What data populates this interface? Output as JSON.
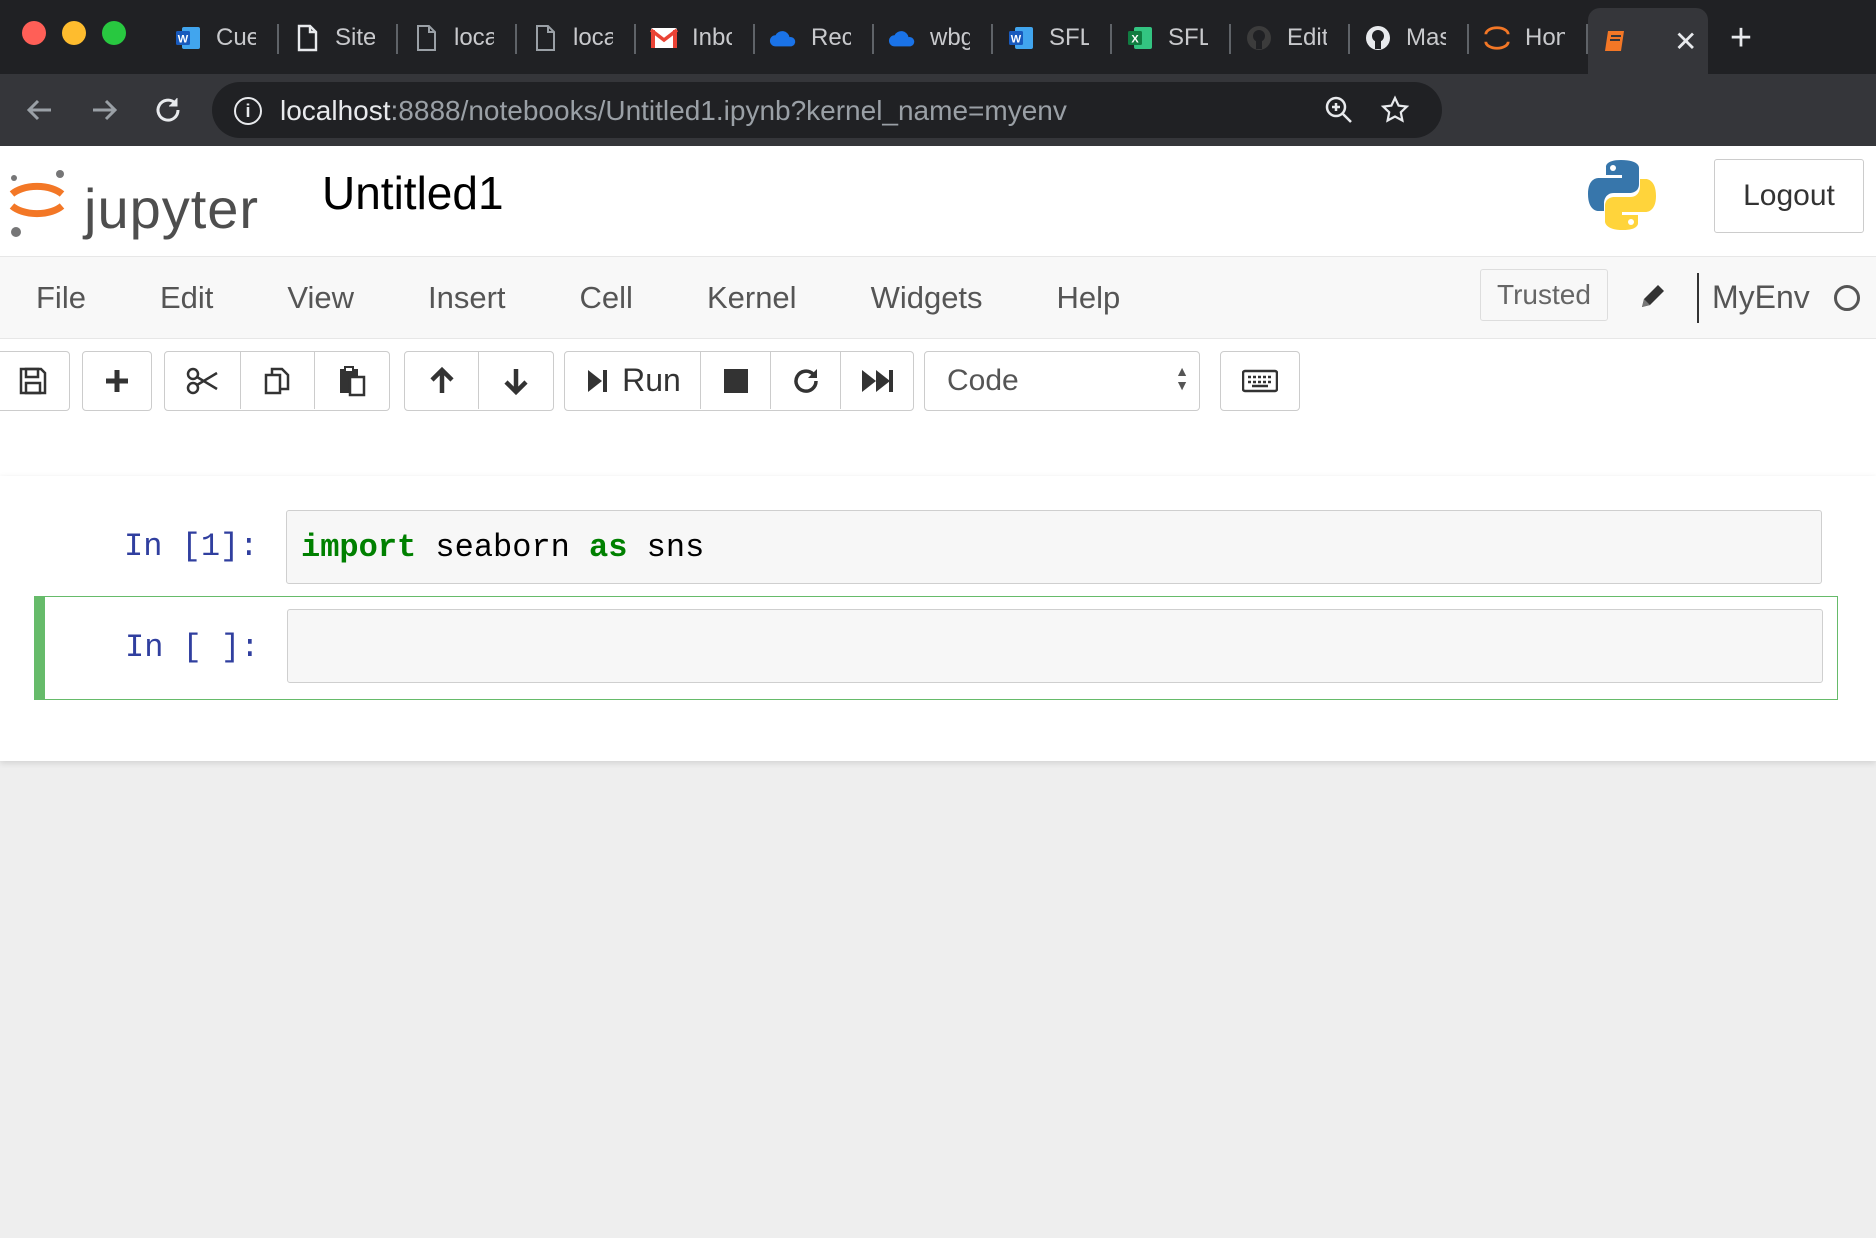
{
  "browser": {
    "tabs": [
      {
        "title": "Cue",
        "icon": "word-icon"
      },
      {
        "title": "Site",
        "icon": "document-icon"
      },
      {
        "title": "loca",
        "icon": "document-icon"
      },
      {
        "title": "loca",
        "icon": "document-icon"
      },
      {
        "title": "Inbo",
        "icon": "gmail-icon"
      },
      {
        "title": "Rec",
        "icon": "onedrive-icon"
      },
      {
        "title": "wbg",
        "icon": "onedrive-icon"
      },
      {
        "title": "SFL",
        "icon": "word-icon"
      },
      {
        "title": "SFL",
        "icon": "excel-icon"
      },
      {
        "title": "Edit",
        "icon": "github-icon"
      },
      {
        "title": "Mas",
        "icon": "github-icon"
      },
      {
        "title": "Hon",
        "icon": "jupyter-icon"
      }
    ],
    "active_tab": {
      "icon": "jupyter-book-icon",
      "close": "✕"
    },
    "new_tab": "+",
    "url_host": "localhost",
    "url_rest": ":8888/notebooks/Untitled1.ipynb?kernel_name=myenv",
    "info_glyph": "i",
    "colors": {
      "titlebar": "#202124",
      "toolbar": "#35363a",
      "omnibox": "#202124"
    }
  },
  "jupyter": {
    "logo_text": "jupyter",
    "notebook_title": "Untitled1",
    "logout_label": "Logout",
    "menu": [
      "File",
      "Edit",
      "View",
      "Insert",
      "Cell",
      "Kernel",
      "Widgets",
      "Help"
    ],
    "trusted_label": "Trusted",
    "kernel_name": "MyEnv",
    "toolbar": {
      "run_label": "Run",
      "cell_type": "Code"
    },
    "cells": [
      {
        "prompt": "In [1]:",
        "code_tokens": [
          {
            "text": "import",
            "kw": true
          },
          {
            "text": " seaborn ",
            "kw": false
          },
          {
            "text": "as",
            "kw": true
          },
          {
            "text": " sns",
            "kw": false
          }
        ]
      },
      {
        "prompt": "In [ ]:",
        "code": ""
      }
    ],
    "colors": {
      "prompt": "#303f9f",
      "keyword": "#008000",
      "selected_cell": "#66bb6a",
      "logo_orange": "#f37726"
    }
  }
}
